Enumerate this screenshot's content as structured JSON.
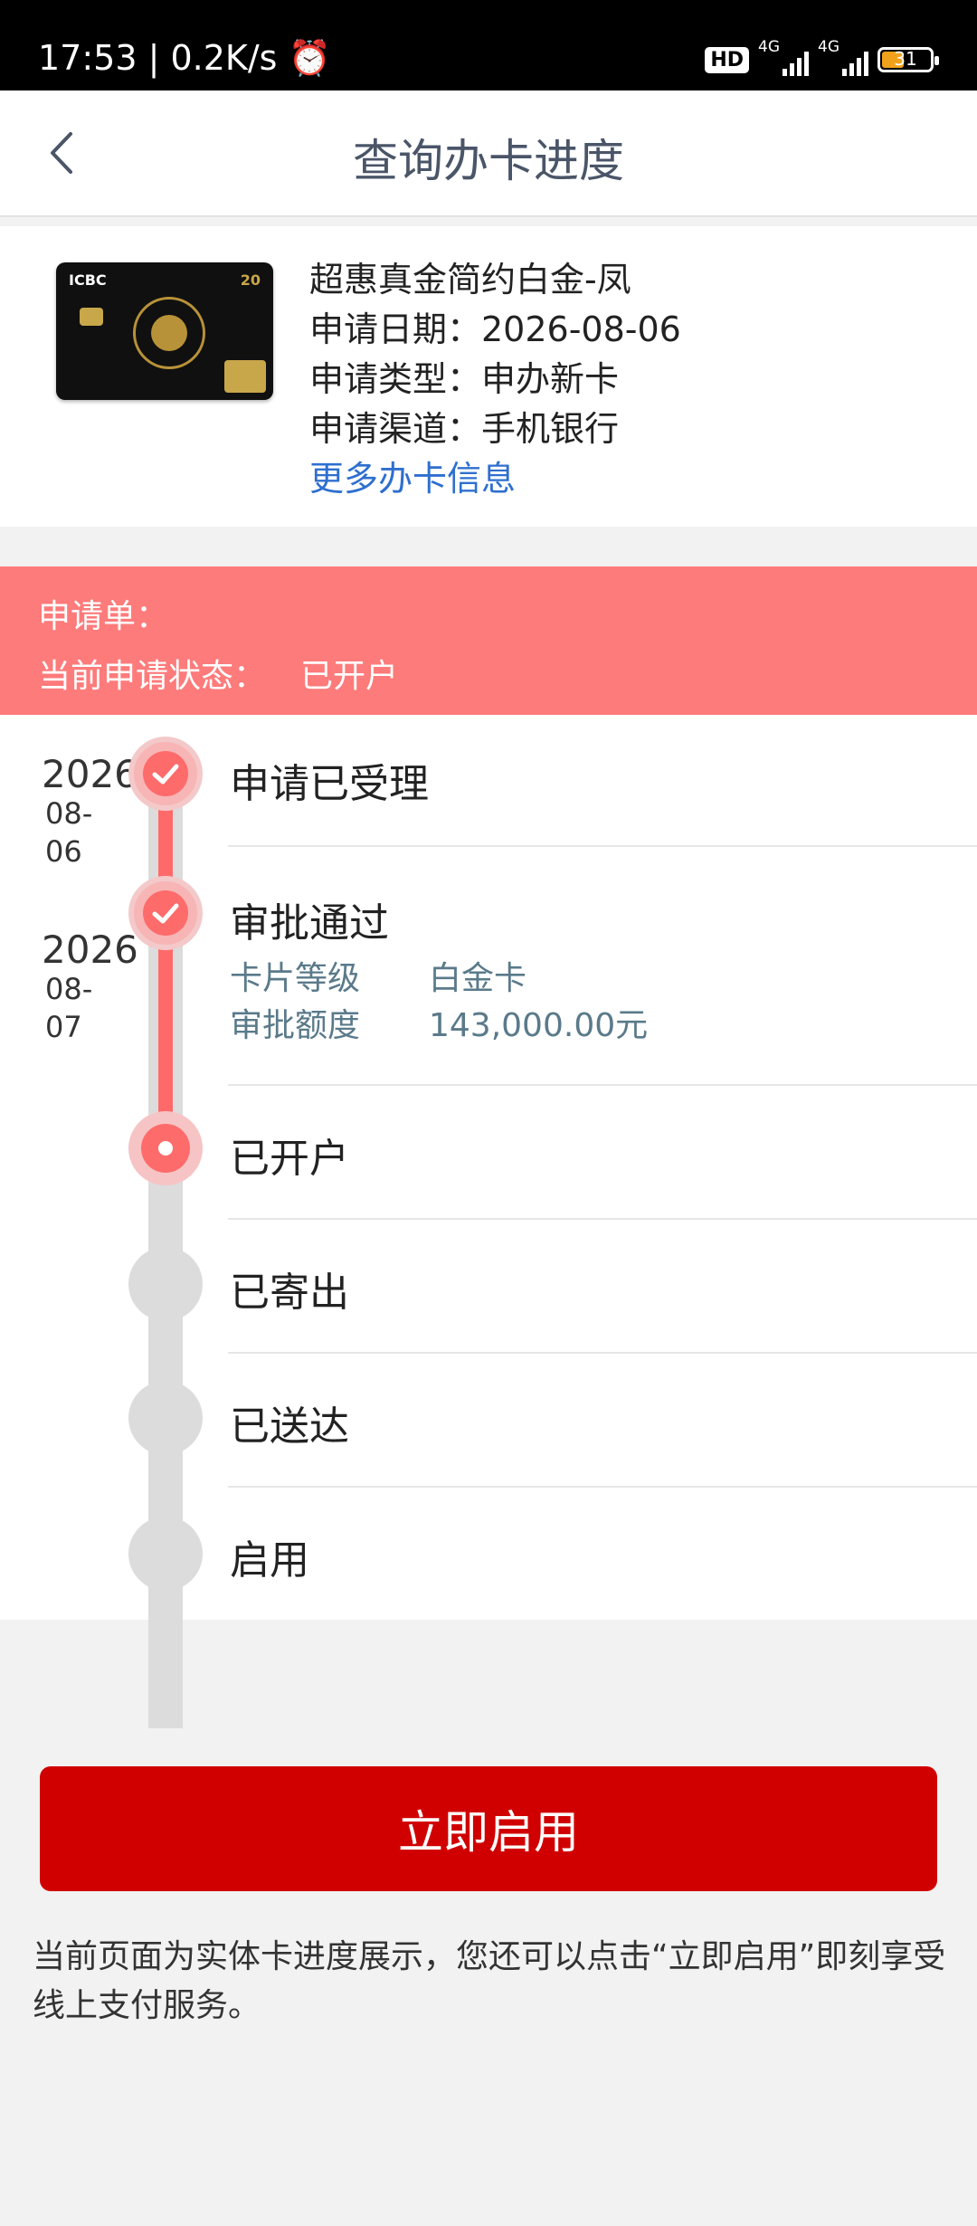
{
  "status_bar": {
    "time_speed": "17:53 | 0.2K/s",
    "hd_label": "HD",
    "network_1": "4G",
    "network_2": "4G",
    "battery": "31"
  },
  "header": {
    "title": "查询办卡进度"
  },
  "card": {
    "name": "超惠真金简约白金-凤",
    "apply_date": "申请日期：2026-08-06",
    "apply_type": "申请类型：申办新卡",
    "apply_channel": "申请渠道：手机银行",
    "more_info_link": "更多办卡信息",
    "card_logo": "ICBC",
    "card_badge": "20"
  },
  "banner": {
    "application_label": "申请单：",
    "status_label": "当前申请状态：",
    "status_value": "已开户"
  },
  "timeline": {
    "steps": [
      {
        "title": "申请已受理",
        "year": "2026",
        "monthday": "08-\n06",
        "state": "done"
      },
      {
        "title": "审批通过",
        "year": "2026",
        "monthday": "08-\n07",
        "state": "done",
        "details": [
          {
            "label": "卡片等级",
            "value": "白金卡"
          },
          {
            "label": "审批额度",
            "value": "143,000.00元"
          }
        ]
      },
      {
        "title": "已开户",
        "state": "current"
      },
      {
        "title": "已寄出",
        "state": "pending"
      },
      {
        "title": "已送达",
        "state": "pending"
      },
      {
        "title": "启用",
        "state": "pending"
      }
    ]
  },
  "actions": {
    "activate_label": "立即启用"
  },
  "note": "当前页面为实体卡进度展示，您还可以点击“立即启用”即刻享受线上支付服务。",
  "colors": {
    "accent_red": "#d10000",
    "banner_bg": "#fe7b7b",
    "progress_red": "#fe6b6b",
    "link_blue": "#2e6fcf"
  }
}
